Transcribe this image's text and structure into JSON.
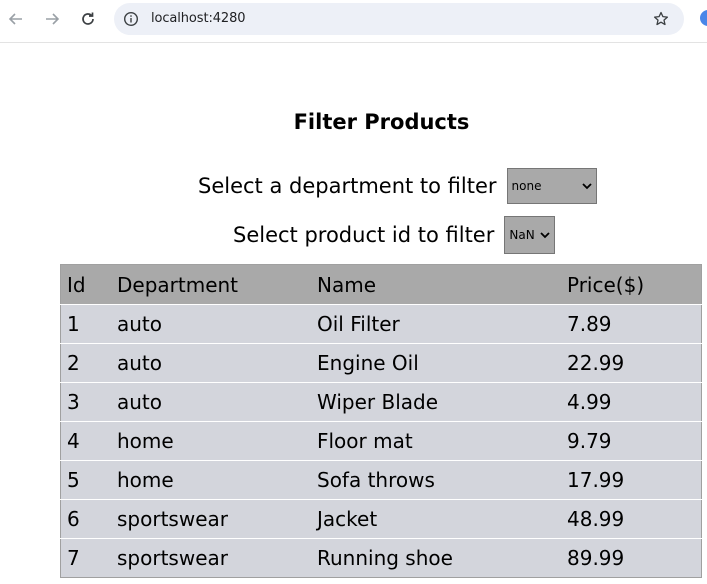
{
  "browser": {
    "url": "localhost:4280"
  },
  "page": {
    "title": "Filter Products",
    "department_filter": {
      "label": "Select a department to filter",
      "selected": "none"
    },
    "id_filter": {
      "label": "Select product id to filter",
      "selected": "NaN"
    }
  },
  "table": {
    "headers": [
      "Id",
      "Department",
      "Name",
      "Price($)"
    ],
    "rows": [
      [
        "1",
        "auto",
        "Oil Filter",
        "7.89"
      ],
      [
        "2",
        "auto",
        "Engine Oil",
        "22.99"
      ],
      [
        "3",
        "auto",
        "Wiper Blade",
        "4.99"
      ],
      [
        "4",
        "home",
        "Floor mat",
        "9.79"
      ],
      [
        "5",
        "home",
        "Sofa throws",
        "17.99"
      ],
      [
        "6",
        "sportswear",
        "Jacket",
        "48.99"
      ],
      [
        "7",
        "sportswear",
        "Running shoe",
        "89.99"
      ]
    ]
  },
  "colors": {
    "header_bg": "#a9a9a9",
    "row_bg": "#d3d5dc",
    "select_bg": "#a9a9a9"
  }
}
